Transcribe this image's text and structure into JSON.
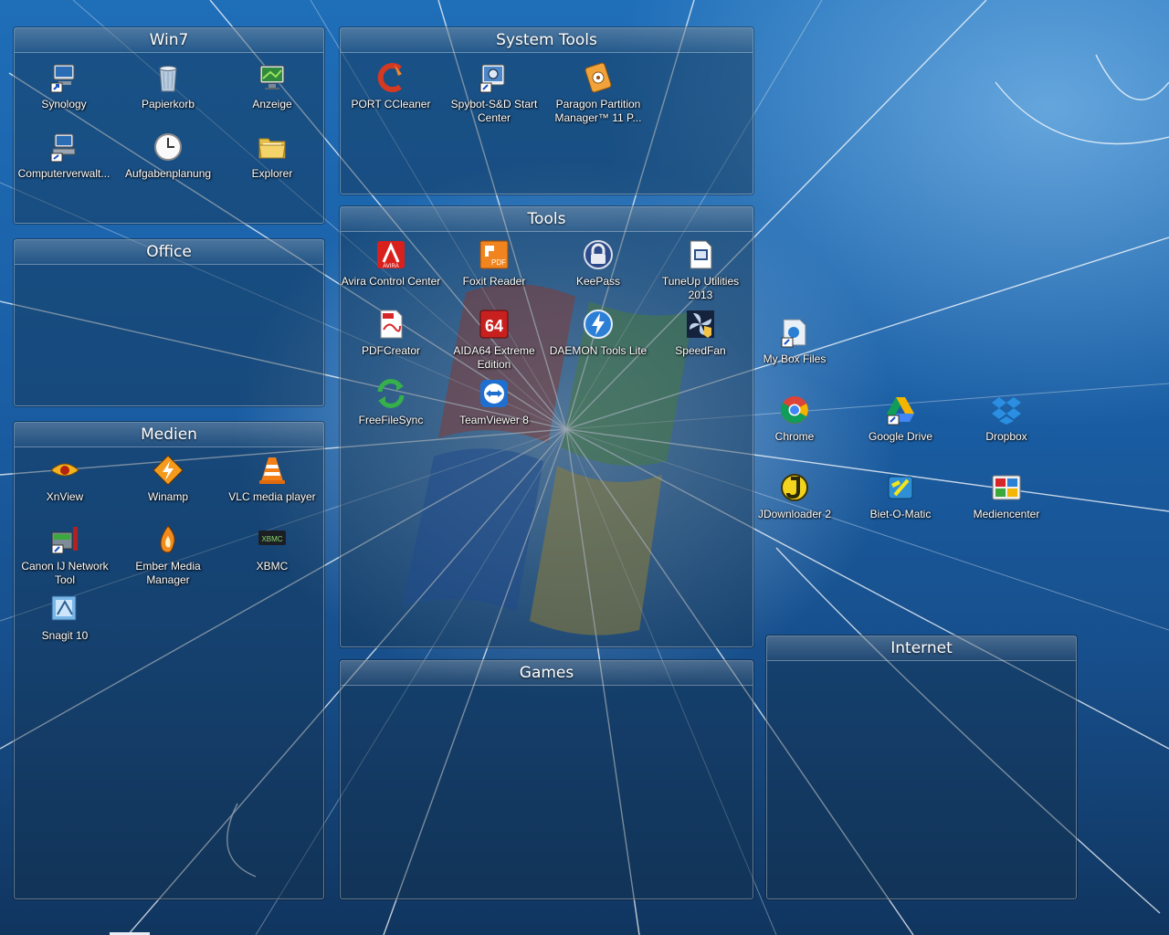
{
  "fences": {
    "win7": {
      "title": "Win7"
    },
    "system_tools": {
      "title": "System Tools"
    },
    "office": {
      "title": "Office"
    },
    "tools": {
      "title": "Tools"
    },
    "medien": {
      "title": "Medien"
    },
    "games": {
      "title": "Games"
    },
    "internet": {
      "title": "Internet"
    }
  },
  "icons": {
    "synology": "Synology",
    "papierkorb": "Papierkorb",
    "anzeige": "Anzeige",
    "computerverwaltung": "Computerverwalt...",
    "aufgabenplanung": "Aufgabenplanung",
    "explorer": "Explorer",
    "port_ccleaner": "PORT CCleaner",
    "spybot": "Spybot-S&D Start Center",
    "paragon": "Paragon Partition Manager™ 11 P...",
    "avira": "Avira Control Center",
    "foxit": "Foxit Reader",
    "keepass": "KeePass",
    "tuneup": "TuneUp Utilities 2013",
    "pdfcreator": "PDFCreator",
    "aida64": "AIDA64 Extreme Edition",
    "daemon": "DAEMON Tools Lite",
    "speedfan": "SpeedFan",
    "freefilesync": "FreeFileSync",
    "teamviewer": "TeamViewer 8",
    "xnview": "XnView",
    "winamp": "Winamp",
    "vlc": "VLC media player",
    "canon": "Canon IJ Network Tool",
    "ember": "Ember Media Manager",
    "xbmc": "XBMC",
    "snagit": "Snagit 10",
    "myboxfiles": "My Box Files",
    "chrome": "Chrome",
    "googledrive": "Google Drive",
    "dropbox": "Dropbox",
    "jdownloader": "JDownloader 2",
    "bietomatic": "Biet-O-Matic",
    "mediencenter": "Mediencenter"
  },
  "icon_badges": {
    "avira": "AVIRA",
    "foxit": "PDF",
    "aida64": "64",
    "xbmc": "XBMC"
  },
  "colors": {
    "accent": "#1a5fa6",
    "fence_bg": "#142d46",
    "label": "#ffffff"
  }
}
